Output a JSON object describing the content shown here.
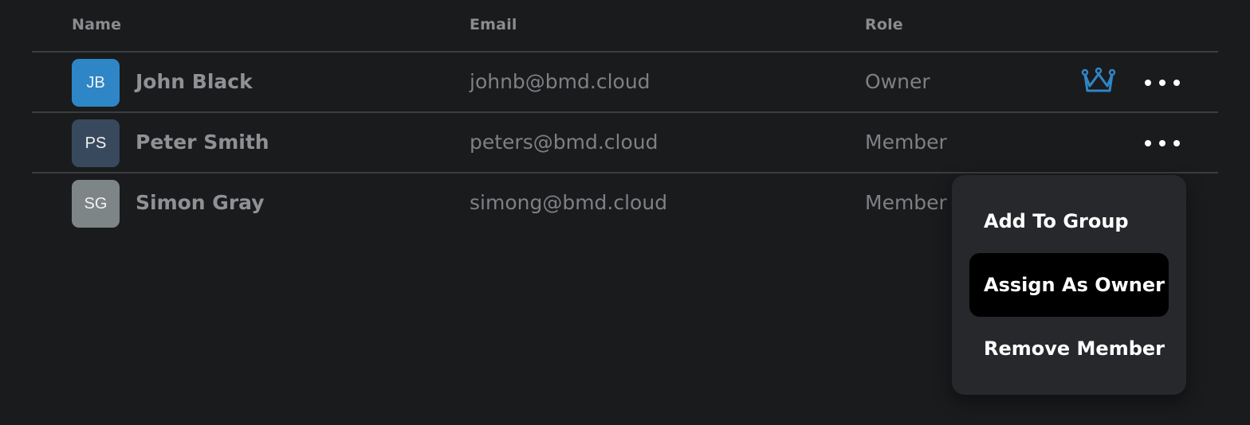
{
  "table": {
    "columns": {
      "name": "Name",
      "email": "Email",
      "role": "Role"
    },
    "rows": [
      {
        "initials": "JB",
        "name": "John Black",
        "email": "johnb@bmd.cloud",
        "role": "Owner",
        "avatar_color": "#2f86c6",
        "owner_icon": "crown-icon"
      },
      {
        "initials": "PS",
        "name": "Peter Smith",
        "email": "peters@bmd.cloud",
        "role": "Member",
        "avatar_color": "#38495d"
      },
      {
        "initials": "SG",
        "name": "Simon Gray",
        "email": "simong@bmd.cloud",
        "role": "Member",
        "avatar_color": "#7d8587"
      }
    ]
  },
  "context_menu": {
    "items": [
      {
        "label": "Add To Group"
      },
      {
        "label": "Assign As Owner",
        "highlighted": true
      },
      {
        "label": "Remove Member"
      }
    ]
  },
  "colors": {
    "background": "#1a1b1d",
    "accent": "#2f86c6",
    "menu_background": "#26282b",
    "menu_highlight": "#000000"
  }
}
